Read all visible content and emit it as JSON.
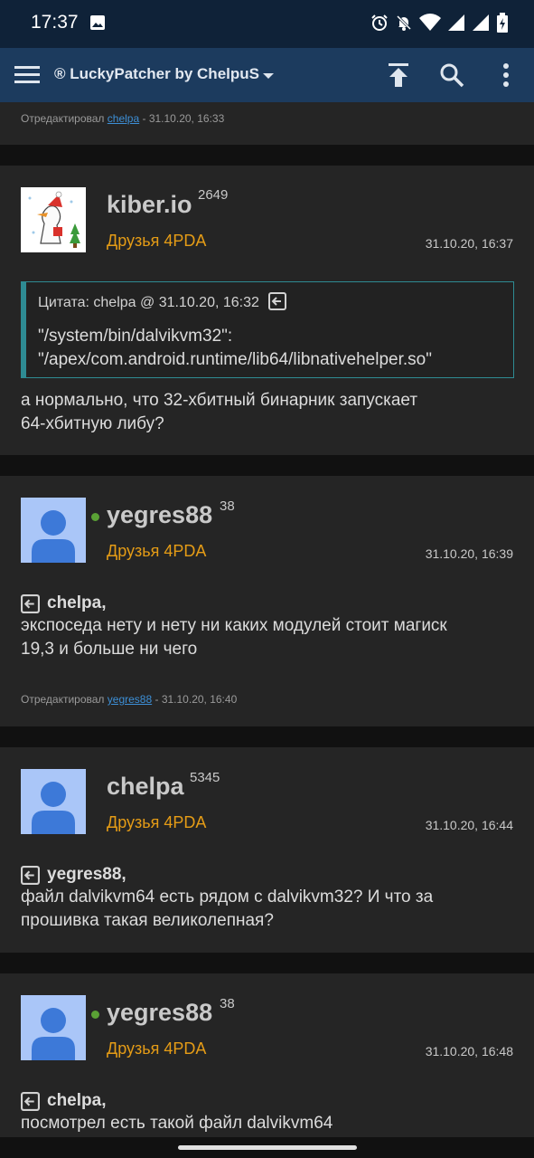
{
  "status_bar": {
    "time": "17:37",
    "icons": [
      "image-icon",
      "alarm-icon",
      "notifications-off-icon",
      "wifi-icon",
      "signal-icon",
      "signal-icon",
      "battery-icon"
    ]
  },
  "app_bar": {
    "title": "® LuckyPatcher by ChelpuS",
    "icons": [
      "menu-icon",
      "dropdown-icon",
      "scroll-top-icon",
      "search-icon",
      "more-vert-icon"
    ]
  },
  "top_edited": {
    "prefix": "Отредактировал",
    "user": "chelpa",
    "suffix": "- 31.10.20, 16:33"
  },
  "posts": [
    {
      "nick": "kiber.io",
      "rep": "2649",
      "group": "Друзья 4PDA",
      "date": "31.10.20, 16:37",
      "quote": {
        "header": "Цитата: chelpa @ 31.10.20, 16:32",
        "line1": "\"/system/bin/dalvikvm32\":",
        "line2": "\"/apex/com.android.runtime/lib64/libnativehelper.so\""
      },
      "text_line1": "а нормально, что 32-хбитный бинарник запускает",
      "text_line2": "64-хбитную либу?"
    },
    {
      "nick": "yegres88",
      "rep": "38",
      "group": "Друзья 4PDA",
      "date": "31.10.20, 16:39",
      "reply_to": "chelpa,",
      "text_line1": "экспоседа нету и нету ни каких модулей стоит магиск",
      "text_line2": "19,3 и больше ни чего",
      "edited": {
        "prefix": "Отредактировал",
        "user": "yegres88",
        "suffix": "- 31.10.20, 16:40"
      }
    },
    {
      "nick": "chelpa",
      "rep": "5345",
      "group": "Друзья 4PDA",
      "date": "31.10.20, 16:44",
      "reply_to": "yegres88,",
      "text_line1": "файл dalvikvm64 есть рядом с dalvikvm32? И что за",
      "text_line2": "прошивка такая великолепная?"
    },
    {
      "nick": "yegres88",
      "rep": "38",
      "group": "Друзья 4PDA",
      "date": "31.10.20, 16:48",
      "reply_to": "chelpa,",
      "text_line1": "посмотрел есть такой файл dalvikvm64"
    }
  ],
  "colors": {
    "status_bar": "#0f2238",
    "app_bar": "#1c3b5e",
    "card": "#252525",
    "group": "#e59c16",
    "quote_border": "#2e8b93",
    "online": "#5aa135",
    "link": "#3d8fd6"
  }
}
